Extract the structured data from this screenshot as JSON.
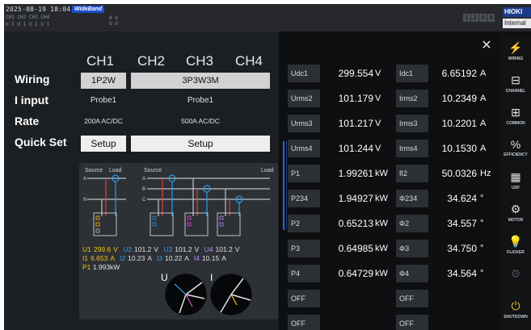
{
  "status": {
    "datetime": "2025-08-19 18:04:16",
    "mode_badge": "WideBand",
    "ch_tags": "CH1 CH2 CH3 CH4",
    "ui_tags": "U I U I U I U I",
    "au_tags": "A U\nU U",
    "pages": [
      "1",
      "2",
      "3",
      "4"
    ],
    "brand": "HIOKI",
    "sync_source": "Internal"
  },
  "config": {
    "channels": [
      "CH1",
      "CH2",
      "CH3",
      "CH4"
    ],
    "row_labels": {
      "wiring": "Wiring",
      "input": "I input",
      "rate": "Rate",
      "quick": "Quick Set"
    },
    "wiring": [
      "1P2W",
      "3P3W3M"
    ],
    "input": [
      "Probe1",
      "Probe1"
    ],
    "rate": [
      "200A AC/DC",
      "500A AC/DC"
    ],
    "setup": [
      "Setup",
      "Setup"
    ]
  },
  "diagram": {
    "left_source": "Source",
    "left_load": "Load",
    "left_line_a": "A",
    "left_line_n": "N",
    "right_source": "Source",
    "right_load": "Load",
    "right_line_a": "A",
    "right_line_b": "B",
    "right_line_c": "C",
    "readings_row1": [
      {
        "label": "U1",
        "value": "299.6",
        "unit": "V"
      },
      {
        "label": "U2",
        "value": "101.2",
        "unit": "V"
      },
      {
        "label": "U3",
        "value": "101.2",
        "unit": "V"
      },
      {
        "label": "U4",
        "value": "101.2",
        "unit": "V"
      }
    ],
    "readings_row2": [
      {
        "label": "I1",
        "value": "6.653",
        "unit": "A"
      },
      {
        "label": "I2",
        "value": "10.23",
        "unit": "A"
      },
      {
        "label": "I3",
        "value": "10.22",
        "unit": "A"
      },
      {
        "label": "I4",
        "value": "10.15",
        "unit": "A"
      }
    ],
    "p1_label": "P1",
    "p1_value": "1.993kW",
    "vector_u": "U",
    "vector_i": "I"
  },
  "measurements": {
    "left": [
      {
        "name": "Udc1",
        "value": "299.554",
        "unit": "V"
      },
      {
        "name": "Urms2",
        "value": "101.179",
        "unit": "V"
      },
      {
        "name": "Urms3",
        "value": "101.217",
        "unit": "V"
      },
      {
        "name": "Urms4",
        "value": "101.244",
        "unit": "V"
      },
      {
        "name": "P1",
        "value": "1.99261",
        "unit": "kW"
      },
      {
        "name": "P234",
        "value": "1.94927",
        "unit": "kW"
      },
      {
        "name": "P2",
        "value": "0.65213",
        "unit": "kW"
      },
      {
        "name": "P3",
        "value": "0.64985",
        "unit": "kW"
      },
      {
        "name": "P4",
        "value": "0.64729",
        "unit": "kW"
      },
      {
        "name": "OFF",
        "value": "",
        "unit": ""
      },
      {
        "name": "OFF",
        "value": "",
        "unit": ""
      }
    ],
    "right": [
      {
        "name": "Idc1",
        "value": "6.65192",
        "unit": "A"
      },
      {
        "name": "Irms2",
        "value": "10.2349",
        "unit": "A"
      },
      {
        "name": "Irms3",
        "value": "10.2201",
        "unit": "A"
      },
      {
        "name": "Irms4",
        "value": "10.1530",
        "unit": "A"
      },
      {
        "name": "fI2",
        "value": "50.0326",
        "unit": "Hz"
      },
      {
        "name": "Φ234",
        "value": "34.624",
        "unit": "°"
      },
      {
        "name": "Φ2",
        "value": "34.557",
        "unit": "°"
      },
      {
        "name": "Φ3",
        "value": "34.750",
        "unit": "°"
      },
      {
        "name": "Φ4",
        "value": "34.564",
        "unit": "°"
      },
      {
        "name": "OFF",
        "value": "",
        "unit": ""
      },
      {
        "name": "OFF",
        "value": "",
        "unit": ""
      }
    ]
  },
  "sidebar": [
    {
      "label": "WIRING",
      "icon": "wiring-icon"
    },
    {
      "label": "CHANNEL",
      "icon": "channel-icon"
    },
    {
      "label": "COMMON",
      "icon": "common-icon"
    },
    {
      "label": "EFFICIENCY",
      "icon": "efficiency-icon"
    },
    {
      "label": "UDF",
      "icon": "udf-icon"
    },
    {
      "label": "MOTOR",
      "icon": "motor-icon"
    },
    {
      "label": "FLICKER",
      "icon": "flicker-icon"
    },
    {
      "label": "",
      "icon": "disabled-icon"
    },
    {
      "label": "SHUTDOWN",
      "icon": "shutdown-icon"
    }
  ],
  "colors": {
    "accent": "#1b3c8c",
    "u1": "#f0c419",
    "u2": "#2e9bf0",
    "u3": "#e94bd6",
    "u4": "#b58cff",
    "scroll": "#2a66d8"
  }
}
